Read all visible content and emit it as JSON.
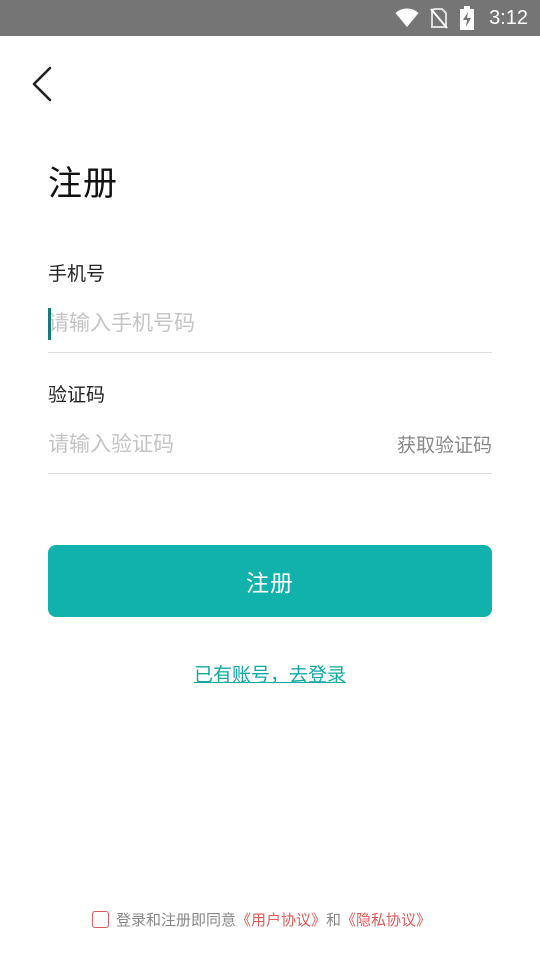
{
  "status_bar": {
    "time": "3:12"
  },
  "page": {
    "title": "注册"
  },
  "phone": {
    "label": "手机号",
    "placeholder": "请输入手机号码"
  },
  "code": {
    "label": "验证码",
    "placeholder": "请输入验证码",
    "get_code_label": "获取验证码"
  },
  "submit_label": "注册",
  "login_link": "已有账号，去登录",
  "agreement": {
    "prefix": "登录和注册即同意",
    "user_agreement": "《用户协议》",
    "and": "和",
    "privacy_policy": "《隐私协议》"
  },
  "colors": {
    "accent": "#10b2ab",
    "link": "#10a8a1",
    "agreement_link": "#e05a5a",
    "status_bar": "#757575"
  },
  "icons": [
    "wifi-icon",
    "no-sim-icon",
    "battery-charging-icon",
    "back-arrow-icon"
  ]
}
